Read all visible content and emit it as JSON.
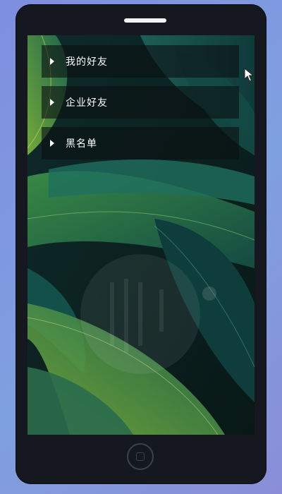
{
  "menu": {
    "items": [
      {
        "label": "我的好友",
        "icon": "caret-right-icon"
      },
      {
        "label": "企业好友",
        "icon": "caret-right-icon"
      },
      {
        "label": "黑名单",
        "icon": "caret-right-icon"
      }
    ]
  },
  "colors": {
    "page_background": "#7f8ee0",
    "phone_body": "#15191f",
    "item_background": "#0c1012",
    "text": "#ffffff",
    "leaf_dark": "#0f3a3a",
    "leaf_light": "#2f7d5a",
    "leaf_highlight": "#b6d43a"
  },
  "icons": {
    "cursor": "arrow-pointer-icon",
    "home": "home-button-icon"
  }
}
